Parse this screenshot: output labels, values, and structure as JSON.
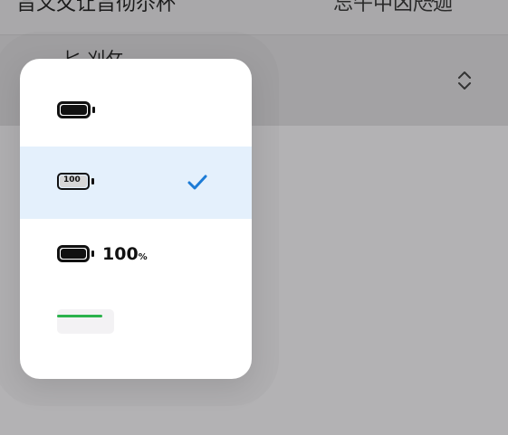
{
  "header": {
    "left_text": "旨义夂让旨彻夵杯",
    "right_text": "忘午中凶咫迦"
  },
  "row": {
    "label": "匕 刈攵"
  },
  "menu": {
    "options": [
      {
        "name": "battery-icon-only",
        "number": "",
        "suffix": "",
        "selected": false
      },
      {
        "name": "battery-with-number-inside",
        "number": "100",
        "suffix": "",
        "selected": true
      },
      {
        "name": "battery-with-percentage",
        "number": "100",
        "suffix": "%",
        "selected": false
      },
      {
        "name": "battery-bar",
        "number": "",
        "suffix": "",
        "selected": false
      }
    ]
  },
  "colors": {
    "accent": "#1c7bd6",
    "selected_bg": "#e4f0fc",
    "bar_green": "#2bb24c",
    "backdrop": "#b3b2b4"
  },
  "icons": {
    "updown": "chevron-up-down-icon",
    "check": "checkmark-icon",
    "chevron_right": "chevron-right-icon"
  }
}
